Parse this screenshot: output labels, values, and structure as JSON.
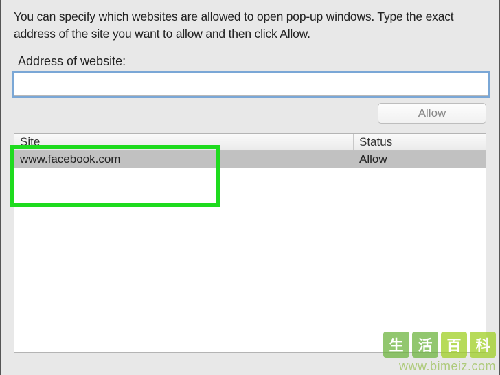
{
  "description": "You can specify which websites are allowed to open pop-up windows. Type the exact address of the site you want to allow and then click Allow.",
  "field_label": "Address of website:",
  "address_input": {
    "value": "",
    "placeholder": ""
  },
  "allow_button_label": "Allow",
  "table": {
    "headers": {
      "site": "Site",
      "status": "Status"
    },
    "rows": [
      {
        "site": "www.facebook.com",
        "status": "Allow"
      }
    ]
  },
  "watermark": {
    "tiles": [
      "生",
      "活",
      "百",
      "科"
    ],
    "url": "www.bimeiz.com"
  }
}
